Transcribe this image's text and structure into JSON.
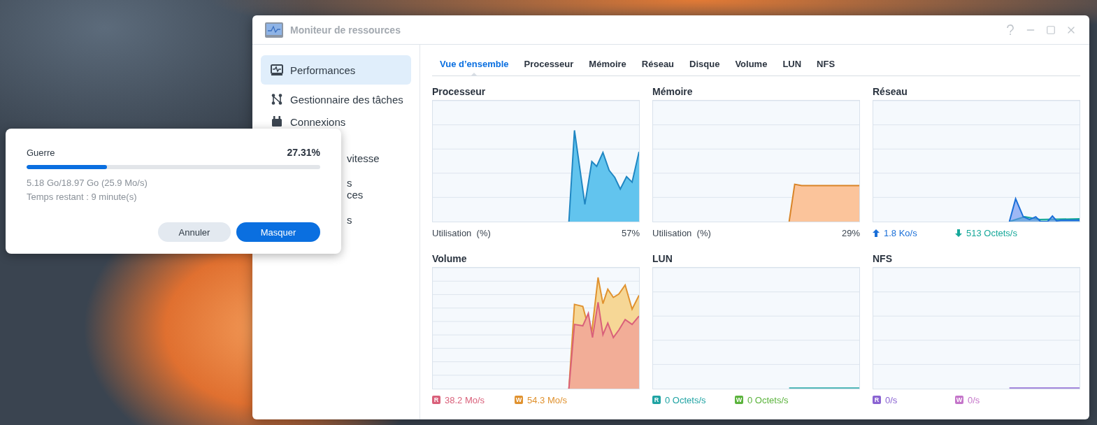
{
  "window": {
    "title": "Moniteur de ressources"
  },
  "sidebar": {
    "items": [
      {
        "label": "Performances",
        "kind": "full",
        "selected": true
      },
      {
        "label": "Gestionnaire des tâches",
        "kind": "full",
        "selected": false
      },
      {
        "label": "Connexions",
        "kind": "full",
        "selected": false
      },
      {
        "label": "vitesse",
        "kind": "partial",
        "selected": false
      },
      {
        "label": "s\nces",
        "kind": "partial",
        "selected": false
      },
      {
        "label": "s",
        "kind": "partial",
        "selected": false
      }
    ]
  },
  "tabs": [
    {
      "label": "Vue d’ensemble",
      "selected": true
    },
    {
      "label": "Processeur",
      "selected": false
    },
    {
      "label": "Mémoire",
      "selected": false
    },
    {
      "label": "Réseau",
      "selected": false
    },
    {
      "label": "Disque",
      "selected": false
    },
    {
      "label": "Volume",
      "selected": false
    },
    {
      "label": "LUN",
      "selected": false
    },
    {
      "label": "NFS",
      "selected": false
    }
  ],
  "panels": [
    {
      "title": "Processeur",
      "usage": {
        "label": "Utilisation  (%)",
        "value": "57%"
      }
    },
    {
      "title": "Mémoire",
      "usage": {
        "label": "Utilisation  (%)",
        "value": "29%"
      }
    },
    {
      "title": "Réseau",
      "legend": [
        {
          "kind": "up",
          "text": "1.8 Ko/s",
          "color": "#1a6fd8"
        },
        {
          "kind": "down",
          "text": "513 Octets/s",
          "color": "#17a89a"
        }
      ]
    },
    {
      "title": "Volume",
      "legend": [
        {
          "kind": "badge",
          "badge": "R",
          "text": "38.2 Mo/s",
          "color": "#d9607a"
        },
        {
          "kind": "badge",
          "badge": "W",
          "text": "54.3 Mo/s",
          "color": "#e0922f"
        }
      ]
    },
    {
      "title": "LUN",
      "legend": [
        {
          "kind": "badge",
          "badge": "R",
          "text": "0 Octets/s",
          "color": "#1fa3a3"
        },
        {
          "kind": "badge",
          "badge": "W",
          "text": "0 Octets/s",
          "color": "#5bb33c"
        }
      ]
    },
    {
      "title": "NFS",
      "legend": [
        {
          "kind": "badge",
          "badge": "R",
          "text": "0/s",
          "color": "#8a63d2"
        },
        {
          "kind": "badge",
          "badge": "W",
          "text": "0/s",
          "color": "#c475c9"
        }
      ]
    }
  ],
  "dialog": {
    "name": "Guerre",
    "percent": "27.31%",
    "level": 0.2731,
    "details": [
      "5.18 Go/18.97 Go (25.9 Mo/s)",
      "Temps restant : 9 minute(s)"
    ],
    "buttons": [
      {
        "label": "Annuler",
        "kind": "secondary"
      },
      {
        "label": "Masquer",
        "kind": "primary"
      }
    ]
  }
}
